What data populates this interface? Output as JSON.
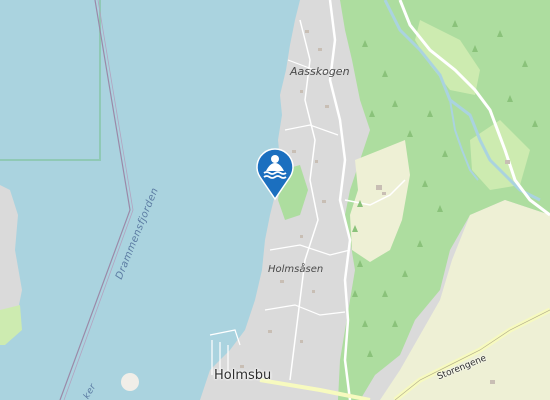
{
  "map": {
    "labels": {
      "aasskogen": "Aasskogen",
      "holmsasen": "Holmsåsen",
      "holmsbu": "Holmsbu",
      "drammensfjorden": "Drammensfjorden",
      "storengene": "Storengene",
      "ker_fragment": "ker"
    },
    "marker": {
      "type": "swimming-area",
      "icon": "swimmer-icon",
      "color": "#1b6fbf"
    },
    "colors": {
      "water": "#aad3df",
      "residential": "#dadada",
      "forest": "#addd9f",
      "farmland": "#eef0d5",
      "meadow": "#cdebb0",
      "road": "#ffffff",
      "boundary": "#8fc9b5",
      "ferry_route": "#9b8aa8"
    }
  }
}
